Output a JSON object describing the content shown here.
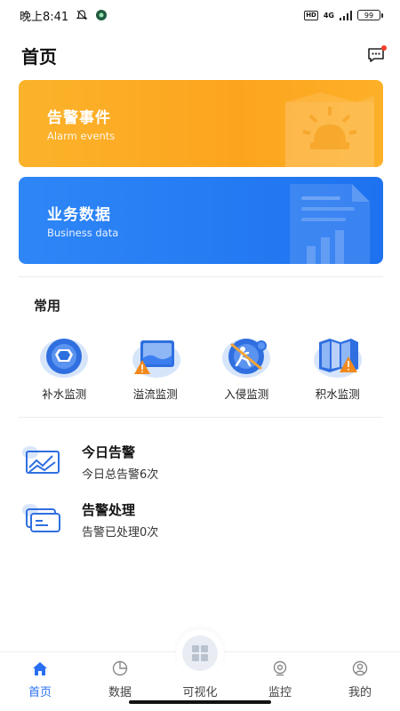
{
  "status_bar": {
    "time": "晚上8:41",
    "network": "4G",
    "battery": "99",
    "hd": "HD"
  },
  "header": {
    "title": "首页"
  },
  "cards": [
    {
      "title": "告警事件",
      "subtitle": "Alarm events",
      "color": "#fca91f"
    },
    {
      "title": "业务数据",
      "subtitle": "Business data",
      "color": "#2a7cf4"
    }
  ],
  "common": {
    "title": "常用",
    "items": [
      {
        "label": "补水监测",
        "icon": "water-supply-icon"
      },
      {
        "label": "溢流监测",
        "icon": "overflow-icon"
      },
      {
        "label": "入侵监测",
        "icon": "intrusion-icon"
      },
      {
        "label": "积水监测",
        "icon": "waterlogging-icon"
      }
    ]
  },
  "alerts": {
    "today": {
      "title": "今日告警",
      "desc": "今日总告警6次",
      "icon": "trend-chart-icon"
    },
    "handled": {
      "title": "告警处理",
      "desc": "告警已处理0次",
      "icon": "cards-icon"
    }
  },
  "nav": {
    "items": [
      {
        "label": "首页",
        "icon": "home-icon",
        "active": true
      },
      {
        "label": "数据",
        "icon": "pie-chart-icon",
        "active": false
      },
      {
        "label": "可视化",
        "icon": "grid-icon",
        "active": false
      },
      {
        "label": "监控",
        "icon": "camera-icon",
        "active": false
      },
      {
        "label": "我的",
        "icon": "user-icon",
        "active": false
      }
    ]
  },
  "colors": {
    "accent": "#2a6ff2",
    "orange": "#fca91f",
    "blue": "#2a7cf4"
  }
}
